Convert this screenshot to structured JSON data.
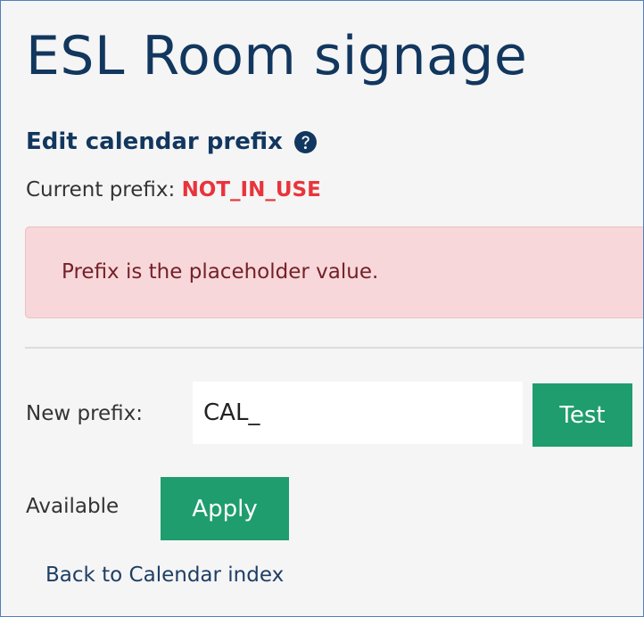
{
  "page": {
    "title": "ESL Room signage"
  },
  "section": {
    "heading": "Edit calendar prefix",
    "help_icon": "question-circle-icon"
  },
  "current_prefix": {
    "label": "Current prefix:",
    "value": "NOT_IN_USE"
  },
  "alert": {
    "message": "Prefix is the placeholder value."
  },
  "form": {
    "label": "New prefix:",
    "input_value": "CAL_",
    "test_button_label": "Test",
    "availability_text": "Available",
    "apply_button_label": "Apply"
  },
  "navigation": {
    "back_link": "Back to Calendar index"
  },
  "colors": {
    "heading": "#12375f",
    "prefix_value": "#e8343c",
    "alert_background": "#f7d7da",
    "alert_text": "#742128",
    "button": "#1f9d6e",
    "frame_border": "#4f81bd"
  }
}
